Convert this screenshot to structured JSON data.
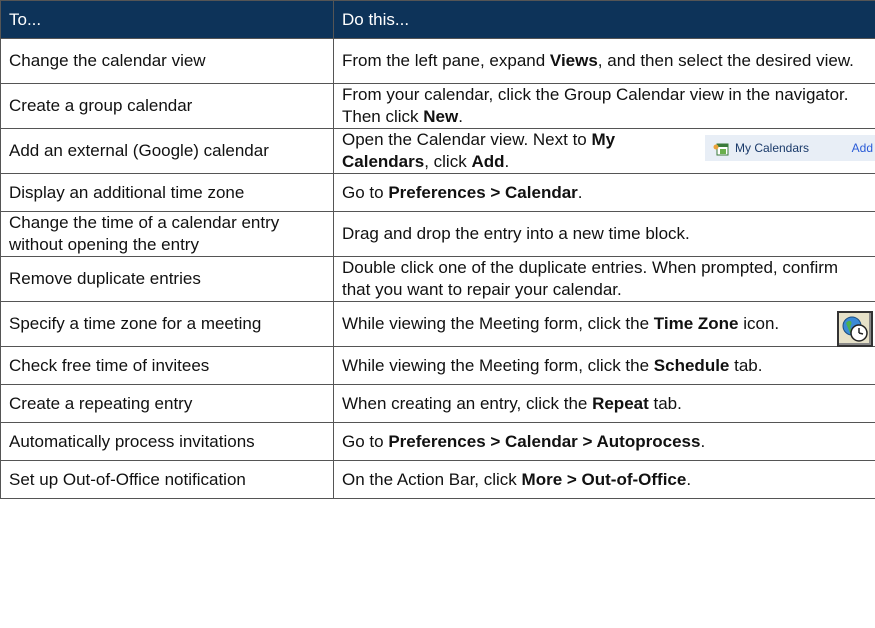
{
  "header": {
    "col_to": "To...",
    "col_do": "Do this..."
  },
  "rows": [
    {
      "to": "Change the calendar view",
      "do": [
        {
          "t": "From the left pane, expand "
        },
        {
          "t": "Views",
          "b": true
        },
        {
          "t": ", and then select the desired view."
        }
      ]
    },
    {
      "to": "Create a group calendar",
      "do": [
        {
          "t": "From your calendar, click the Group Calendar view in the navigator.  Then click "
        },
        {
          "t": "New",
          "b": true
        },
        {
          "t": "."
        }
      ]
    },
    {
      "to": "Add an external (Google) calendar",
      "do": [
        {
          "t": "Open the Calendar view.  Next to "
        },
        {
          "t": "My Calendars",
          "b": true
        },
        {
          "t": ", click "
        },
        {
          "t": "Add",
          "b": true
        },
        {
          "t": "."
        }
      ],
      "snip": {
        "label": "My Calendars",
        "add": "Add",
        "icon": "calendar-add-icon"
      }
    },
    {
      "to": "Display an additional time zone",
      "do": [
        {
          "t": "Go to "
        },
        {
          "t": "Preferences > Calendar",
          "b": true
        },
        {
          "t": "."
        }
      ]
    },
    {
      "to": "Change the time of a calendar entry without opening the entry",
      "do": [
        {
          "t": "Drag and drop the entry into a new time block."
        }
      ]
    },
    {
      "to": "Remove duplicate entries",
      "do": [
        {
          "t": "Double click one of the duplicate entries.  When prompted, confirm that you want to repair your calendar."
        }
      ]
    },
    {
      "to": "Specify a time zone for a meeting",
      "do": [
        {
          "t": "While viewing the Meeting form, click the "
        },
        {
          "t": "Time Zone",
          "b": true
        },
        {
          "t": " icon."
        }
      ],
      "tz_icon": "time-zone-icon"
    },
    {
      "to": "Check free time of invitees",
      "do": [
        {
          "t": "While viewing the Meeting form, click the "
        },
        {
          "t": "Schedule",
          "b": true
        },
        {
          "t": " tab."
        }
      ]
    },
    {
      "to": "Create a repeating entry",
      "do": [
        {
          "t": "When creating an entry, click the "
        },
        {
          "t": "Repeat",
          "b": true
        },
        {
          "t": " tab."
        }
      ]
    },
    {
      "to": "Automatically process invitations",
      "do": [
        {
          "t": "Go to "
        },
        {
          "t": "Preferences > Calendar > Autoprocess",
          "b": true
        },
        {
          "t": "."
        }
      ]
    },
    {
      "to": "Set up Out-of-Office notification",
      "do": [
        {
          "t": "On the Action Bar, click "
        },
        {
          "t": "More > Out-of-Office",
          "b": true
        },
        {
          "t": "."
        }
      ]
    }
  ],
  "colors": {
    "header_bg": "#0d3359",
    "border": "#555555"
  }
}
